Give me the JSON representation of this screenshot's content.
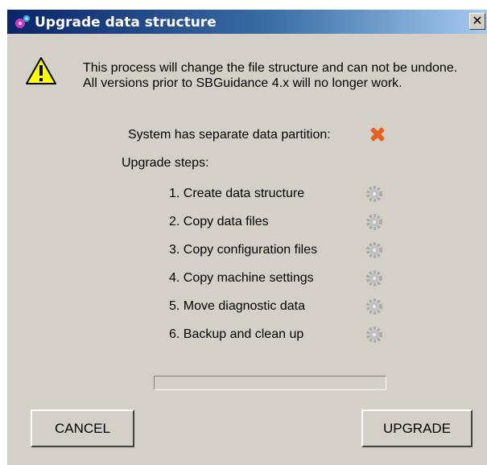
{
  "window": {
    "title": "Upgrade data structure",
    "close_label": "✕"
  },
  "warning": {
    "message": "This process will change the file structure and can not be undone. All versions prior to SBGuidance 4.x will no longer work."
  },
  "partition": {
    "label": "System has separate data partition:",
    "status_icon": "red-x-icon"
  },
  "steps": {
    "heading": "Upgrade steps:",
    "items": [
      {
        "label": "1. Create data structure",
        "status_icon": "gear-icon"
      },
      {
        "label": "2. Copy data files",
        "status_icon": "gear-icon"
      },
      {
        "label": "3. Copy configuration files",
        "status_icon": "gear-icon"
      },
      {
        "label": "4. Copy machine settings",
        "status_icon": "gear-icon"
      },
      {
        "label": "5. Move diagnostic data",
        "status_icon": "gear-icon"
      },
      {
        "label": "6. Backup and clean up",
        "status_icon": "gear-icon"
      }
    ]
  },
  "progress": {
    "value": 0
  },
  "buttons": {
    "cancel": "CANCEL",
    "upgrade": "UPGRADE"
  },
  "colors": {
    "titlebar_start": "#0a246a",
    "titlebar_end": "#a6caf0",
    "dialog_bg": "#d4d0c8",
    "error_x": "#e8601c"
  }
}
